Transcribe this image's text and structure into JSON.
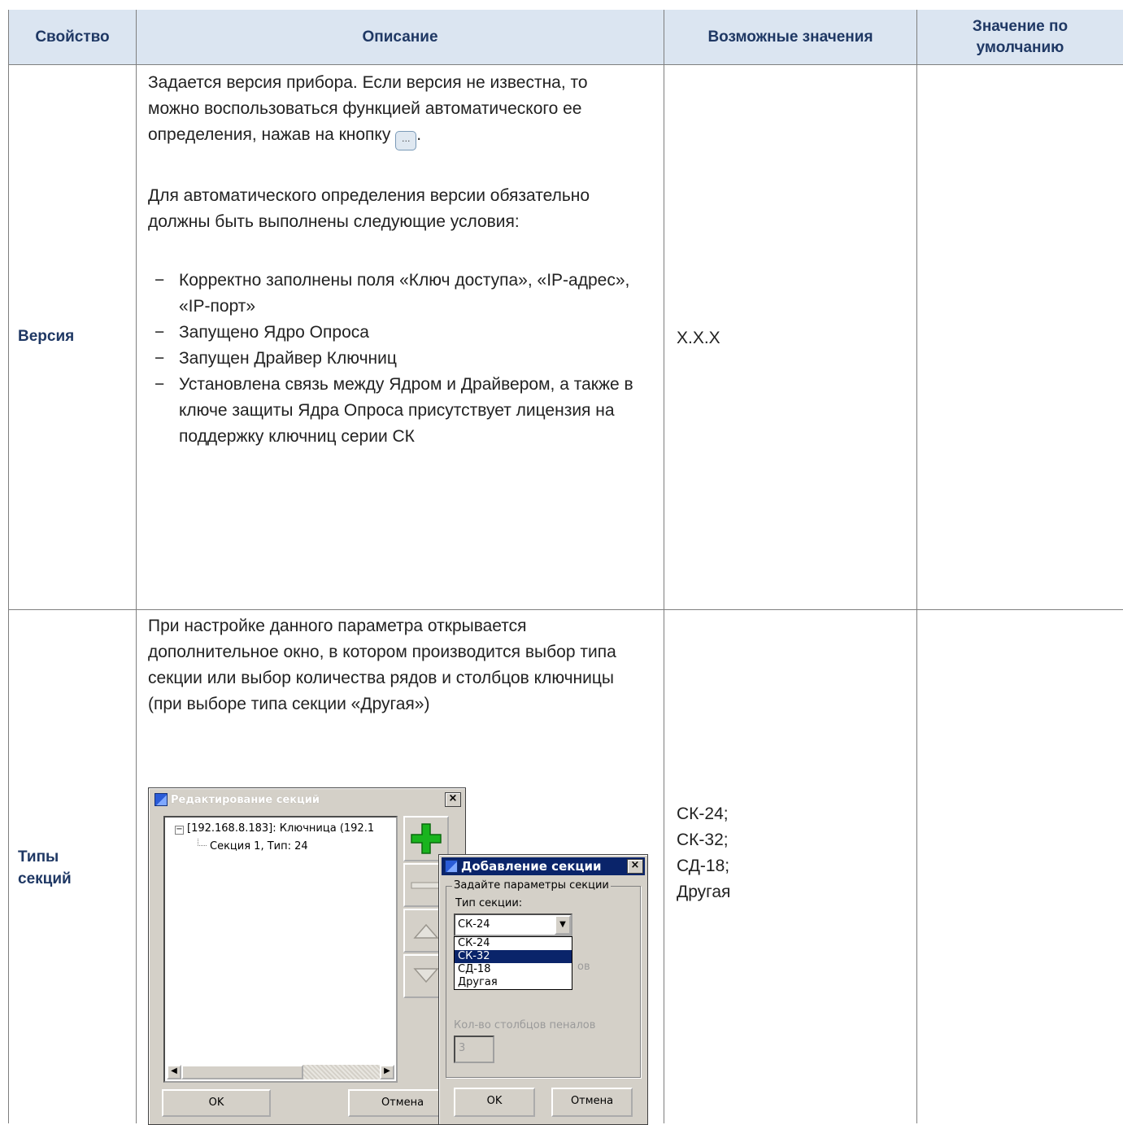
{
  "header": {
    "col_property": "Свойство",
    "col_description": "Описание",
    "col_values": "Возможные значения",
    "col_default": "Значение по умолчанию"
  },
  "rows": [
    {
      "property": "Версия",
      "description": {
        "p1_before_button": "Задается версия прибора. Если версия не известна, то можно воспользоваться функцией автоматического ее определения, нажав на кнопку",
        "p1_after_button": ".",
        "button_icon": "ellipsis-button-icon",
        "p2": "Для автоматического определения версии обязательно должны быть выполнены следующие условия:",
        "bullets": [
          "Корректно заполнены поля «Ключ доступа», «IP-адрес», «IP-порт»",
          "Запущено Ядро Опроса",
          "Запущен Драйвер Ключниц",
          "Установлена связь между Ядром и Драйвером, а также в ключе защиты Ядра Опроса присутствует лицензия на поддержку ключниц серии СК"
        ],
        "bullet_mark": "−"
      },
      "values": "X.X.X",
      "default": ""
    },
    {
      "property": "Типы секций",
      "description": {
        "p1": "При настройке данного параметра открывается дополнительное окно, в котором производится выбор типа секции или выбор количества рядов и столбцов ключницы (при выборе типа секции «Другая»)"
      },
      "values": [
        "СК-24;",
        "СК-32;",
        "СД-18;",
        "Другая"
      ],
      "default": ""
    }
  ],
  "dialog_edit": {
    "title": "Редактирование секций",
    "close_glyph": "×",
    "tree_root": "[192.168.8.183]: Ключница (192.1",
    "tree_child": "Секция 1, Тип: 24",
    "ok_label": "OK",
    "cancel_label": "Отмена"
  },
  "dialog_add": {
    "title": "Добавление секции",
    "close_glyph": "×",
    "group_title": "Задайте параметры секции",
    "type_label": "Тип секции:",
    "type_value": "СК-24",
    "options": [
      "СК-24",
      "СК-32",
      "СД-18",
      "Другая"
    ],
    "selected_option": "СК-32",
    "rows_label_fragment": "ов",
    "cols_label": "Кол-во столбцов пеналов",
    "cols_value": "3",
    "ok_label": "OK",
    "cancel_label": "Отмена"
  },
  "colors": {
    "header_bg": "#dbe5f1",
    "header_text": "#1f3864",
    "border": "#7f7f7f",
    "dialog_face": "#d4d0c8",
    "selection": "#0a246a"
  }
}
